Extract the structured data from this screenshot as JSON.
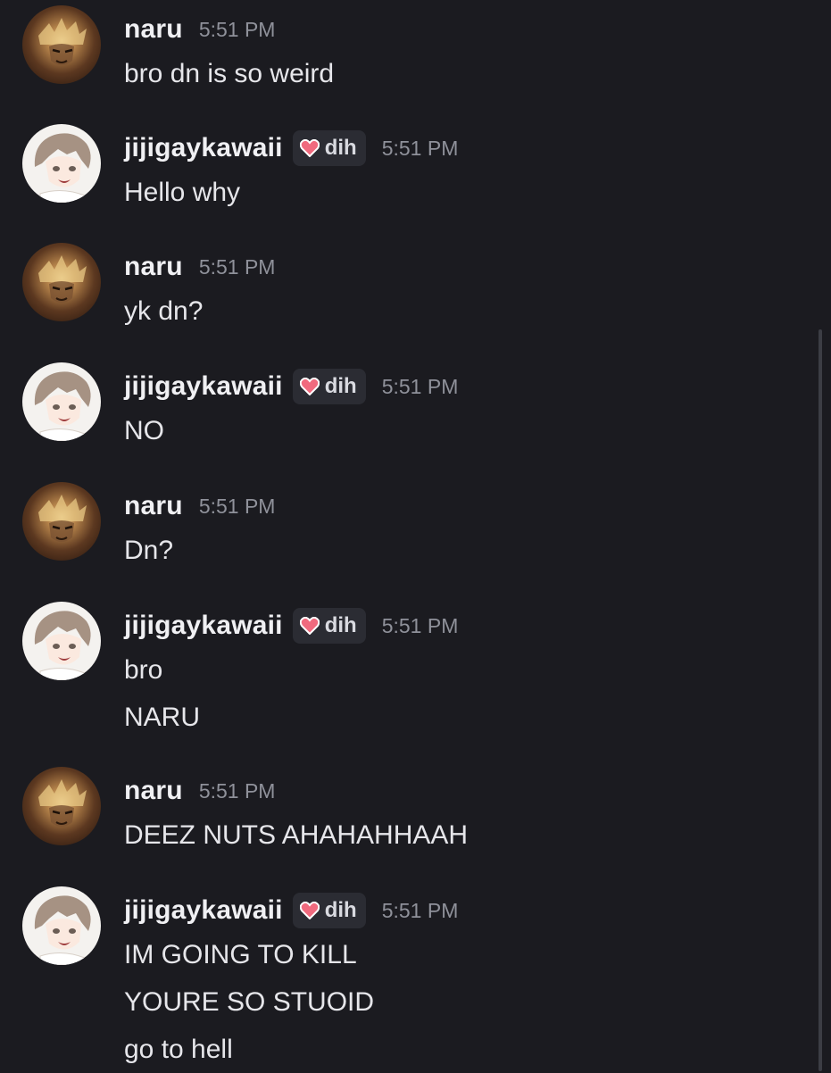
{
  "messages": [
    {
      "user": "naru",
      "avatar": "naru-avatar",
      "role": null,
      "time": "5:51 PM",
      "lines": [
        "bro dn is so weird"
      ]
    },
    {
      "user": "jijigaykawaii",
      "avatar": "jiji-avatar",
      "role": "dih",
      "time": "5:51 PM",
      "lines": [
        "Hello why"
      ]
    },
    {
      "user": "naru",
      "avatar": "naru-avatar",
      "role": null,
      "time": "5:51 PM",
      "lines": [
        "yk dn?"
      ]
    },
    {
      "user": "jijigaykawaii",
      "avatar": "jiji-avatar",
      "role": "dih",
      "time": "5:51 PM",
      "lines": [
        "NO"
      ]
    },
    {
      "user": "naru",
      "avatar": "naru-avatar",
      "role": null,
      "time": "5:51 PM",
      "lines": [
        "Dn?"
      ]
    },
    {
      "user": "jijigaykawaii",
      "avatar": "jiji-avatar",
      "role": "dih",
      "time": "5:51 PM",
      "lines": [
        "bro",
        "NARU"
      ]
    },
    {
      "user": "naru",
      "avatar": "naru-avatar",
      "role": null,
      "time": "5:51 PM",
      "lines": [
        "DEEZ NUTS AHAHAHHAAH"
      ]
    },
    {
      "user": "jijigaykawaii",
      "avatar": "jiji-avatar",
      "role": "dih",
      "time": "5:51 PM",
      "lines": [
        "IM GOING TO KILL",
        "YOURE SO STUOID",
        "go to hell"
      ]
    }
  ],
  "role_icon": "heart-icon",
  "colors": {
    "background": "#1b1b20",
    "role_tag_bg": "#2b2c33",
    "role_heart": "#f06a7e",
    "timestamp": "#8f919a"
  }
}
